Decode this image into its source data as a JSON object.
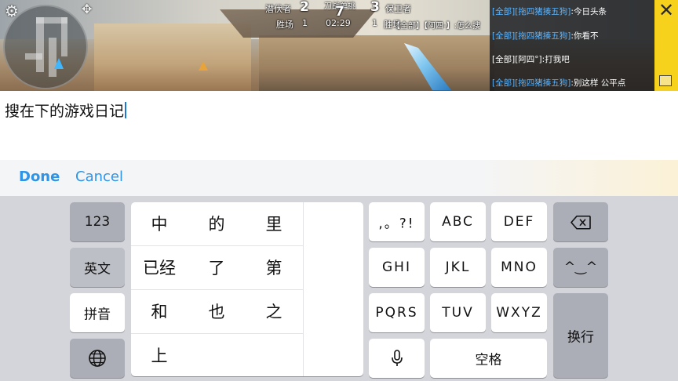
{
  "game": {
    "team_left": "潜伏者",
    "team_left_score": "2",
    "mode": "刀战单挑",
    "round_score": "7",
    "team_right_score": "3",
    "team_right": "保卫者",
    "wins_left_label": "胜场",
    "wins_left": "1",
    "timer": "02:29",
    "wins_right": "1",
    "wins_right_label": "胜场",
    "overlay_chat": "【全部】【阿四-】:怎么搜"
  },
  "chat": [
    {
      "tag": "[全部]",
      "name": "[拖四猪揍五狗]",
      "msg": ":今日头条"
    },
    {
      "tag": "[全部]",
      "name": "[拖四猪揍五狗]",
      "msg": ":你看不"
    },
    {
      "tag": "[全部]",
      "name": "[阿四°]",
      "msg": ":打我吧"
    },
    {
      "tag": "[全部]",
      "name": "[拖四猪揍五狗]",
      "msg": ":别这样 公平点"
    }
  ],
  "input": {
    "value": "搜在下的游戏日记"
  },
  "accessory": {
    "done": "Done",
    "cancel": "Cancel"
  },
  "keyboard": {
    "left_keys": [
      "123",
      "英文",
      "拼音"
    ],
    "candidates": [
      [
        "中",
        "的",
        "里"
      ],
      [
        "已经",
        "了",
        "第"
      ],
      [
        "和",
        "也",
        "之"
      ],
      [
        "上"
      ]
    ],
    "t9_keys": [
      [
        ",。?!",
        "ABC",
        "DEF"
      ],
      [
        "GHI",
        "JKL",
        "MNO"
      ],
      [
        "PQRS",
        "TUV",
        "WXYZ"
      ]
    ],
    "space": "空格",
    "enter": "换行",
    "emoji": "^‿^",
    "delete": "⌫",
    "globe": "🌐",
    "mic": "🎤"
  }
}
